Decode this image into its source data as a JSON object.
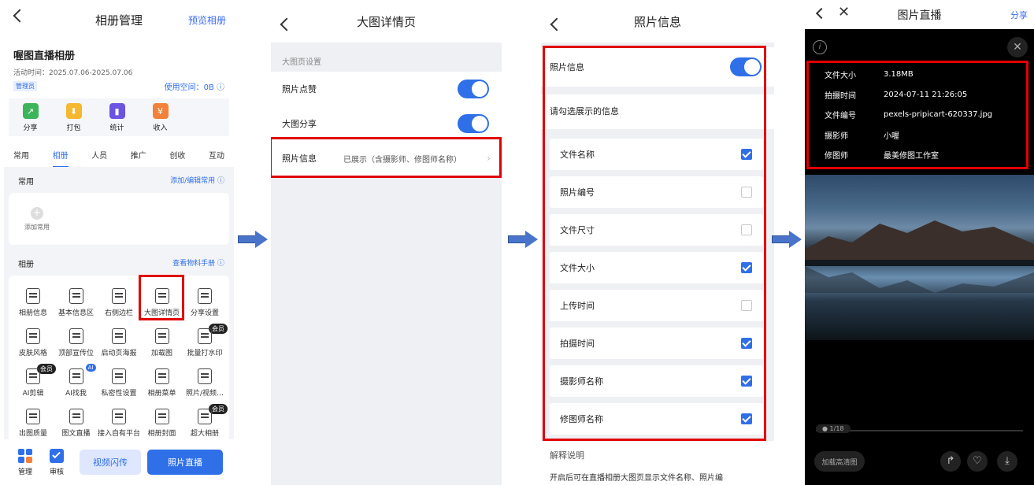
{
  "p1": {
    "title": "相册管理",
    "preview": "预览相册",
    "album_name": "喔图直播相册",
    "activity_time": "活动时间：2025.07.06-2025.07.06",
    "role": "管理员",
    "space": "使用空间：0B",
    "quick": [
      {
        "label": "分享",
        "color": "#3cb45a"
      },
      {
        "label": "打包",
        "color": "#f5b82e"
      },
      {
        "label": "统计",
        "color": "#6a54e0"
      },
      {
        "label": "收入",
        "color": "#f2823a"
      }
    ],
    "tabs": [
      "常用",
      "相册",
      "人员",
      "推广",
      "创收",
      "互动"
    ],
    "active_tab": "相册",
    "common_title": "常用",
    "common_action": "添加/编辑常用",
    "add_common": "添加常用",
    "album_title": "相册",
    "album_action": "查看物料手册",
    "grid": [
      {
        "label": "相册信息",
        "badge": ""
      },
      {
        "label": "基本信息区",
        "badge": ""
      },
      {
        "label": "右侧边栏",
        "badge": ""
      },
      {
        "label": "大图详情页",
        "badge": ""
      },
      {
        "label": "分享设置",
        "badge": ""
      },
      {
        "label": "皮肤风格",
        "badge": ""
      },
      {
        "label": "顶部宣传位",
        "badge": ""
      },
      {
        "label": "启动页海报",
        "badge": ""
      },
      {
        "label": "加载图",
        "badge": ""
      },
      {
        "label": "批量打水印",
        "badge": "会员"
      },
      {
        "label": "AI剪辑",
        "badge": "会员"
      },
      {
        "label": "AI找我",
        "badge": "AI"
      },
      {
        "label": "私密性设置",
        "badge": ""
      },
      {
        "label": "相册菜单",
        "badge": ""
      },
      {
        "label": "照片/视频…",
        "badge": ""
      },
      {
        "label": "出图质量",
        "badge": ""
      },
      {
        "label": "图文直播",
        "badge": ""
      },
      {
        "label": "接入自有平台",
        "badge": ""
      },
      {
        "label": "相册封面",
        "badge": ""
      },
      {
        "label": "超大相册",
        "badge": "会员"
      }
    ],
    "bottom_manage": "管理",
    "bottom_review": "审核",
    "btn_video": "视频闪传",
    "btn_live": "照片直播"
  },
  "p2": {
    "title": "大图详情页",
    "section": "大图页设置",
    "like": "照片点赞",
    "share": "大图分享",
    "info_label": "照片信息",
    "info_value": "已展示（含摄影师、修图师名称）"
  },
  "p3": {
    "title": "照片信息",
    "info_label": "照片信息",
    "choose": "请勾选展示的信息",
    "items": [
      {
        "label": "文件名称",
        "on": true
      },
      {
        "label": "照片编号",
        "on": false
      },
      {
        "label": "文件尺寸",
        "on": false
      },
      {
        "label": "文件大小",
        "on": true
      },
      {
        "label": "上传时间",
        "on": false
      },
      {
        "label": "拍摄时间",
        "on": true
      },
      {
        "label": "摄影师名称",
        "on": true
      },
      {
        "label": "修图师名称",
        "on": true
      }
    ],
    "explain_title": "解释说明",
    "explain_text": "开启后可在直播相册大图页显示文件名称、照片编"
  },
  "p4": {
    "title": "图片直播",
    "share": "分享",
    "rows": [
      {
        "k": "文件大小",
        "v": "3.18MB"
      },
      {
        "k": "拍摄时间",
        "v": "2024-07-11 21:26:05"
      },
      {
        "k": "文件编号",
        "v": "pexels-pripicart-620337.jpg"
      },
      {
        "k": "摄影师",
        "v": "小喔"
      },
      {
        "k": "修图师",
        "v": "最美修图工作室"
      }
    ],
    "counter": "1/18",
    "hd": "加载高清图"
  }
}
